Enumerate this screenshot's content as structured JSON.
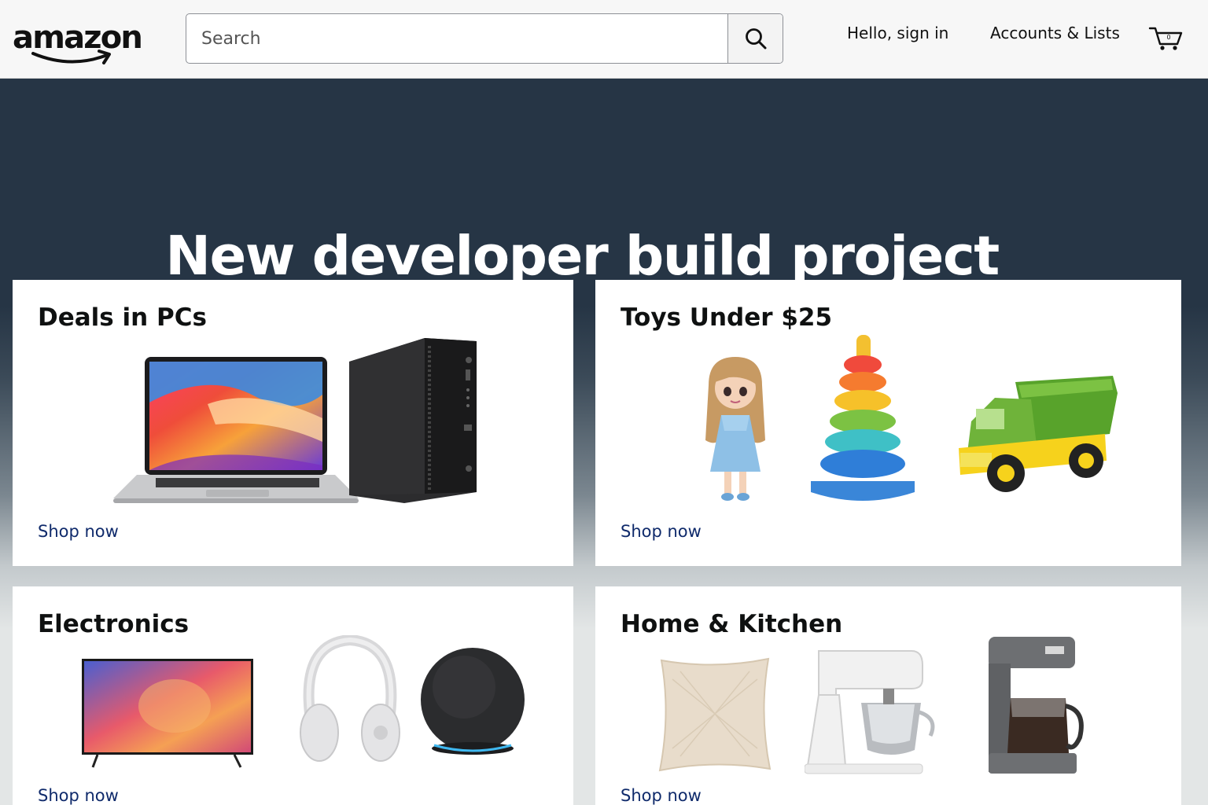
{
  "header": {
    "logo_text": "amazon",
    "search": {
      "placeholder": "Search",
      "value": ""
    },
    "signin_label": "Hello, sign in",
    "accounts_label": "Accounts & Lists",
    "cart_count": "0"
  },
  "hero": {
    "title": "New developer build project"
  },
  "cards": [
    {
      "title": "Deals in PCs",
      "link": "Shop now",
      "products": [
        "laptop",
        "desktop-tower"
      ]
    },
    {
      "title": "Toys Under $25",
      "link": "Shop now",
      "products": [
        "doll",
        "stacking-rings",
        "toy-truck"
      ]
    },
    {
      "title": "Electronics",
      "link": "Shop now",
      "products": [
        "television",
        "headphones",
        "smart-speaker"
      ]
    },
    {
      "title": "Home & Kitchen",
      "link": "Shop now",
      "products": [
        "throw-pillow",
        "stand-mixer",
        "coffee-maker"
      ]
    }
  ],
  "icons": {
    "search": "search-icon",
    "cart": "cart-icon",
    "logo_smile": "smile-arrow-icon"
  },
  "colors": {
    "hero_bg": "#263545",
    "link": "#0f2a6b",
    "page_bg": "#e3e6e6"
  }
}
